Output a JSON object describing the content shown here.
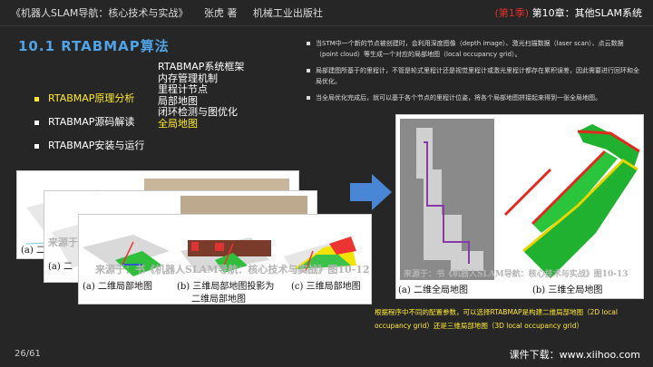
{
  "header": {
    "book": "《机器人SLAM导航：核心技术与实战》",
    "author": "张虎 著",
    "publisher": "机械工业出版社",
    "episode": "(第1季)",
    "chapter": "第10章：其他SLAM系统"
  },
  "section_title": "10.1 RTABMAP算法",
  "subitems": [
    "RTABMAP系统框架",
    "内存管理机制",
    "里程计节点",
    "局部地图",
    "闭环检测与图优化",
    "全局地图"
  ],
  "menu": [
    "RTABMAP原理分析",
    "RTABMAP源码解读",
    "RTABMAP安装与运行"
  ],
  "bullets": [
    "当STM中一个新的节点被创建时，会利用深度图像（depth image）、激光扫描数据（laser scan）、点云数据（point cloud）等生成一个对应的局部地图（local occupancy grid）。",
    "局部建图所基于的里程计，不管是轮式里程计还是视觉里程计或激光里程计都存在累积误差，因此需要进行回环和全局优化。",
    "当全局优化完成后，就可以基于各个节点的里程计位姿，将各个局部地图拼接起来得到一张全局地图。"
  ],
  "figures": {
    "left": {
      "cap_a": "(a) 二维局部地图",
      "cap_b1": "(b) 三维局部地图投影为",
      "cap_b2": "二维局部地图",
      "cap_c": "(c) 三维局部地图",
      "watermark": "来源于：书《机器人SLAM导航：核心技术与实战》图10-12",
      "back_cap": "(a) 二",
      "back_watermark": "来源于：",
      "back_cap2": "(a) 二"
    },
    "right": {
      "cap_a": "(a) 二维全局地图",
      "cap_b": "(b) 三维全局地图",
      "watermark": "来源于：书《机器人SLAM导航：核心技术与实战》图10-13"
    }
  },
  "bottom_note": "根据程序中不同的配置参数，可以选择RTABMAP是构建二维局部地图（2D local occupancy grid）还是三维局部地图（3D local occupancy grid）",
  "footer": {
    "page": "26/61",
    "download": "课件下载：www.xiihoo.com"
  }
}
